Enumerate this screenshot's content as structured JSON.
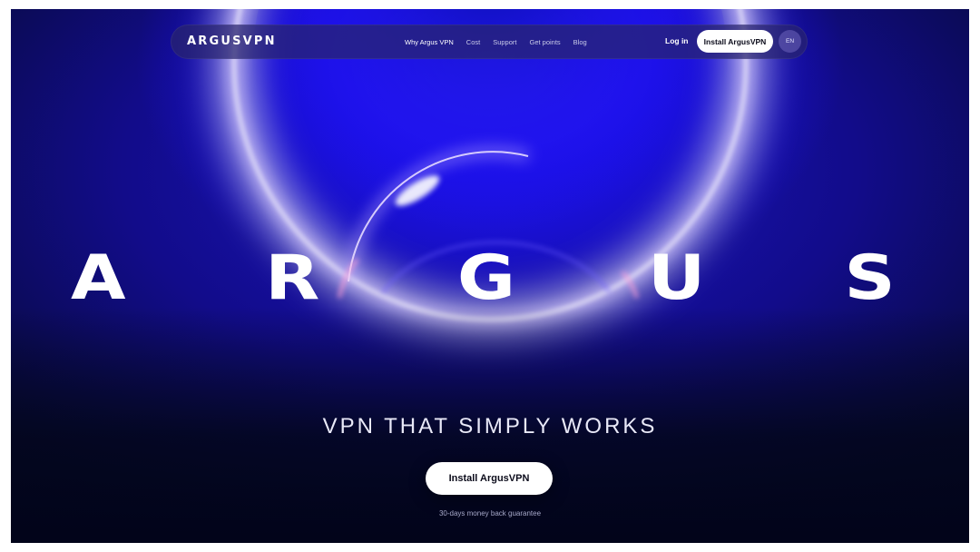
{
  "brand": {
    "logo_text": "ARGUSVPN",
    "hero_letters": [
      "A",
      "R",
      "G",
      "U",
      "S"
    ]
  },
  "nav": {
    "links": [
      {
        "label": "Why Argus VPN",
        "active": true
      },
      {
        "label": "Cost",
        "active": false
      },
      {
        "label": "Support",
        "active": false
      },
      {
        "label": "Get points",
        "active": false
      },
      {
        "label": "Blog",
        "active": false
      }
    ],
    "login_label": "Log in",
    "install_label": "Install ArgusVPN",
    "language": "EN"
  },
  "hero": {
    "tagline": "VPN THAT SIMPLY WORKS",
    "cta_label": "Install ArgusVPN",
    "guarantee": "30-days money back guarantee"
  },
  "colors": {
    "background_deep": "#03061c",
    "background_blue": "#1a10e6",
    "glow": "#ffffff",
    "ring_accent": "#c4a3ff",
    "button_bg": "#ffffff",
    "button_text": "#0b0b1a"
  }
}
